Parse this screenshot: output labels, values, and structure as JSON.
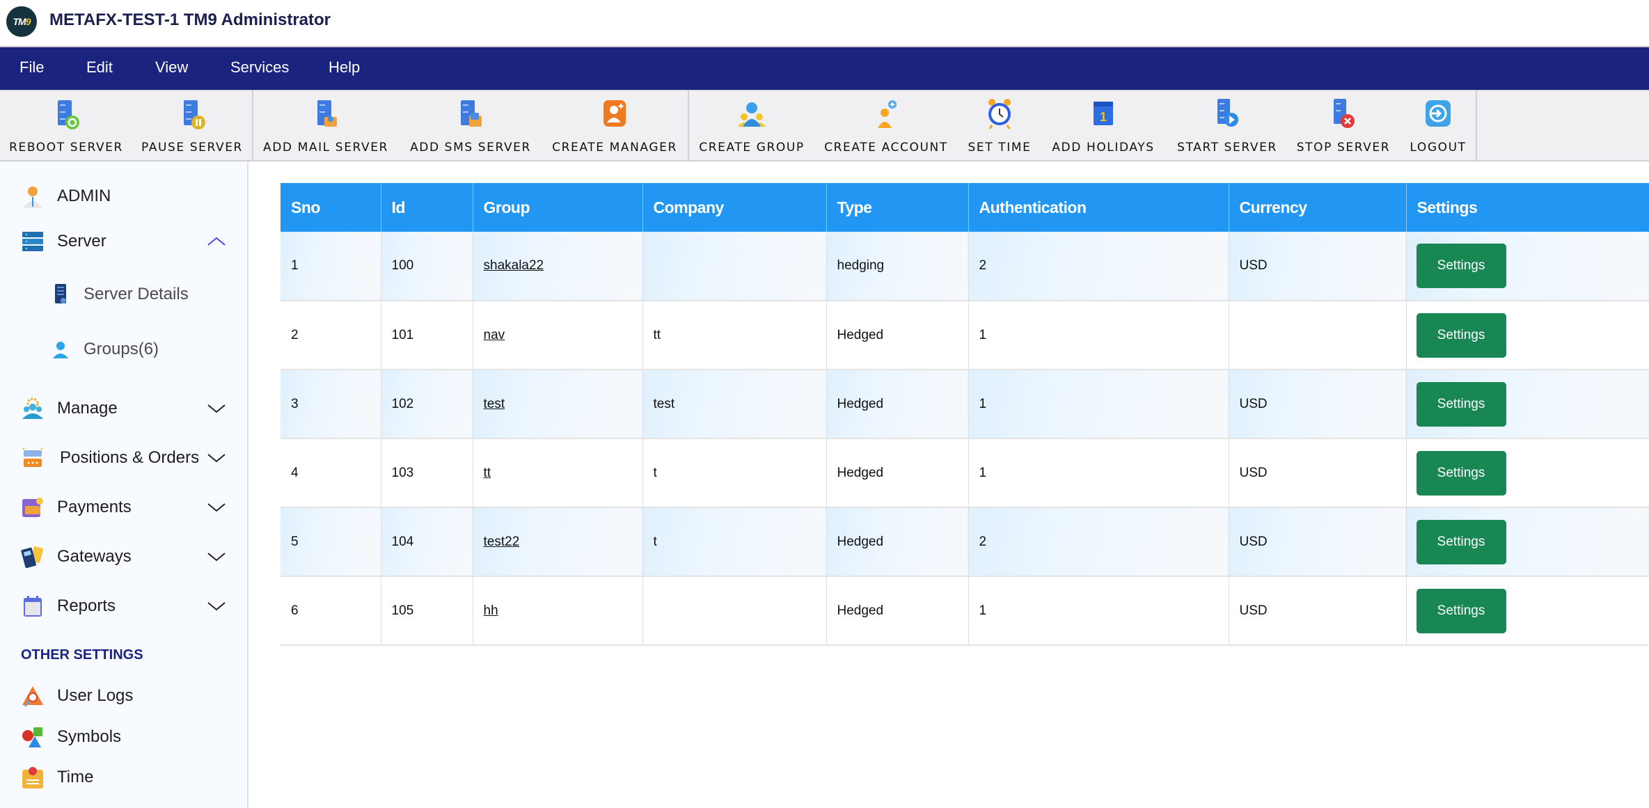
{
  "app": {
    "title": "METAFX-TEST-1 TM9 Administrator",
    "logo_text": "TM",
    "logo_accent": "9"
  },
  "menu": [
    "File",
    "Edit",
    "View",
    "Services",
    "Help"
  ],
  "toolbar": [
    {
      "label": "REBOOT SERVER",
      "icon": "reboot-server-icon"
    },
    {
      "label": "PAUSE SERVER",
      "icon": "pause-server-icon"
    },
    {
      "label": "ADD MAIL SERVER",
      "icon": "add-mail-server-icon"
    },
    {
      "label": "ADD SMS SERVER",
      "icon": "add-sms-server-icon"
    },
    {
      "label": "CREATE MANAGER",
      "icon": "create-manager-icon"
    },
    {
      "label": "CREATE GROUP",
      "icon": "create-group-icon"
    },
    {
      "label": "CREATE ACCOUNT",
      "icon": "create-account-icon"
    },
    {
      "label": "SET TIME",
      "icon": "alarm-clock-icon"
    },
    {
      "label": "ADD HOLIDAYS",
      "icon": "calendar-icon"
    },
    {
      "label": "START SERVER",
      "icon": "start-server-icon"
    },
    {
      "label": "STOP SERVER",
      "icon": "stop-server-icon"
    },
    {
      "label": "LOGOUT",
      "icon": "logout-icon"
    }
  ],
  "sidebar": {
    "items": [
      {
        "label": "ADMIN",
        "icon": "admin-user-icon"
      },
      {
        "label": "Server",
        "icon": "server-stack-icon",
        "expanded": true
      },
      {
        "label": "Server Details",
        "icon": "server-tower-icon",
        "sub": true
      },
      {
        "label": "Groups(6)",
        "icon": "group-user-icon",
        "sub": true
      },
      {
        "label": "Manage",
        "icon": "manage-team-icon",
        "expanded": false
      },
      {
        "label": "Positions & Orders",
        "icon": "positions-orders-icon",
        "expanded": false
      },
      {
        "label": "Payments",
        "icon": "payments-wallet-icon",
        "expanded": false
      },
      {
        "label": "Gateways",
        "icon": "gateway-terminal-icon",
        "expanded": false
      },
      {
        "label": "Reports",
        "icon": "reports-calendar-icon",
        "expanded": false
      }
    ],
    "other_settings_title": "OTHER SETTINGS",
    "other_items": [
      {
        "label": "User Logs",
        "icon": "user-logs-icon"
      },
      {
        "label": "Symbols",
        "icon": "symbols-shapes-icon"
      },
      {
        "label": "Time",
        "icon": "time-badge-icon"
      }
    ]
  },
  "table": {
    "columns": [
      "Sno",
      "Id",
      "Group",
      "Company",
      "Type",
      "Authentication",
      "Currency",
      "Settings"
    ],
    "rows": [
      {
        "sno": "1",
        "id": "100",
        "group": "shakala22",
        "company": "",
        "type": "hedging",
        "authentication": "2",
        "currency": "USD",
        "settings_label": "Settings"
      },
      {
        "sno": "2",
        "id": "101",
        "group": "nav",
        "company": "tt",
        "type": "Hedged",
        "authentication": "1",
        "currency": "",
        "settings_label": "Settings"
      },
      {
        "sno": "3",
        "id": "102",
        "group": "test",
        "company": "test",
        "type": "Hedged",
        "authentication": "1",
        "currency": "USD",
        "settings_label": "Settings"
      },
      {
        "sno": "4",
        "id": "103",
        "group": "tt",
        "company": "t",
        "type": "Hedged",
        "authentication": "1",
        "currency": "USD",
        "settings_label": "Settings"
      },
      {
        "sno": "5",
        "id": "104",
        "group": "test22",
        "company": "t",
        "type": "Hedged",
        "authentication": "2",
        "currency": "USD",
        "settings_label": "Settings"
      },
      {
        "sno": "6",
        "id": "105",
        "group": "hh",
        "company": "",
        "type": "Hedged",
        "authentication": "1",
        "currency": "USD",
        "settings_label": "Settings"
      }
    ]
  },
  "colors": {
    "menubar": "#1a237e",
    "table_header": "#2196f3",
    "settings_button": "#198754",
    "section_title": "#1a237e"
  }
}
